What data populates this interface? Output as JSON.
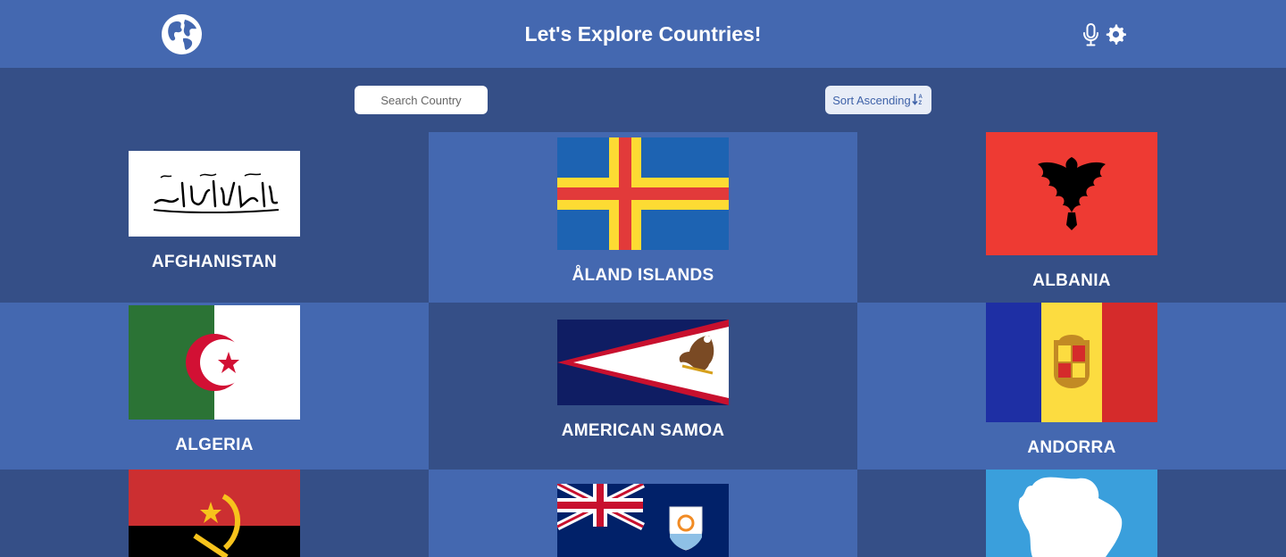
{
  "header": {
    "title": "Let's Explore Countries!",
    "logo_icon": "globe-icon",
    "mic_icon": "microphone-icon",
    "settings_icon": "gear-icon"
  },
  "toolbar": {
    "search_placeholder": "Search Country",
    "sort_label": "Sort Ascending",
    "sort_icon": "sort-ascending-icon"
  },
  "colors": {
    "header_bg": "#4468b0",
    "page_bg": "#354f87",
    "card_light": "#4468b0",
    "card_dark": "#354f87"
  },
  "countries": [
    {
      "name": "AFGHANISTAN",
      "flag": "flag-afghanistan"
    },
    {
      "name": "ÅLAND ISLANDS",
      "flag": "flag-aland-islands"
    },
    {
      "name": "ALBANIA",
      "flag": "flag-albania"
    },
    {
      "name": "ALGERIA",
      "flag": "flag-algeria"
    },
    {
      "name": "AMERICAN SAMOA",
      "flag": "flag-american-samoa"
    },
    {
      "name": "ANDORRA",
      "flag": "flag-andorra"
    },
    {
      "name": "",
      "flag": "flag-angola"
    },
    {
      "name": "",
      "flag": "flag-anguilla"
    },
    {
      "name": "",
      "flag": "flag-antarctica"
    }
  ]
}
